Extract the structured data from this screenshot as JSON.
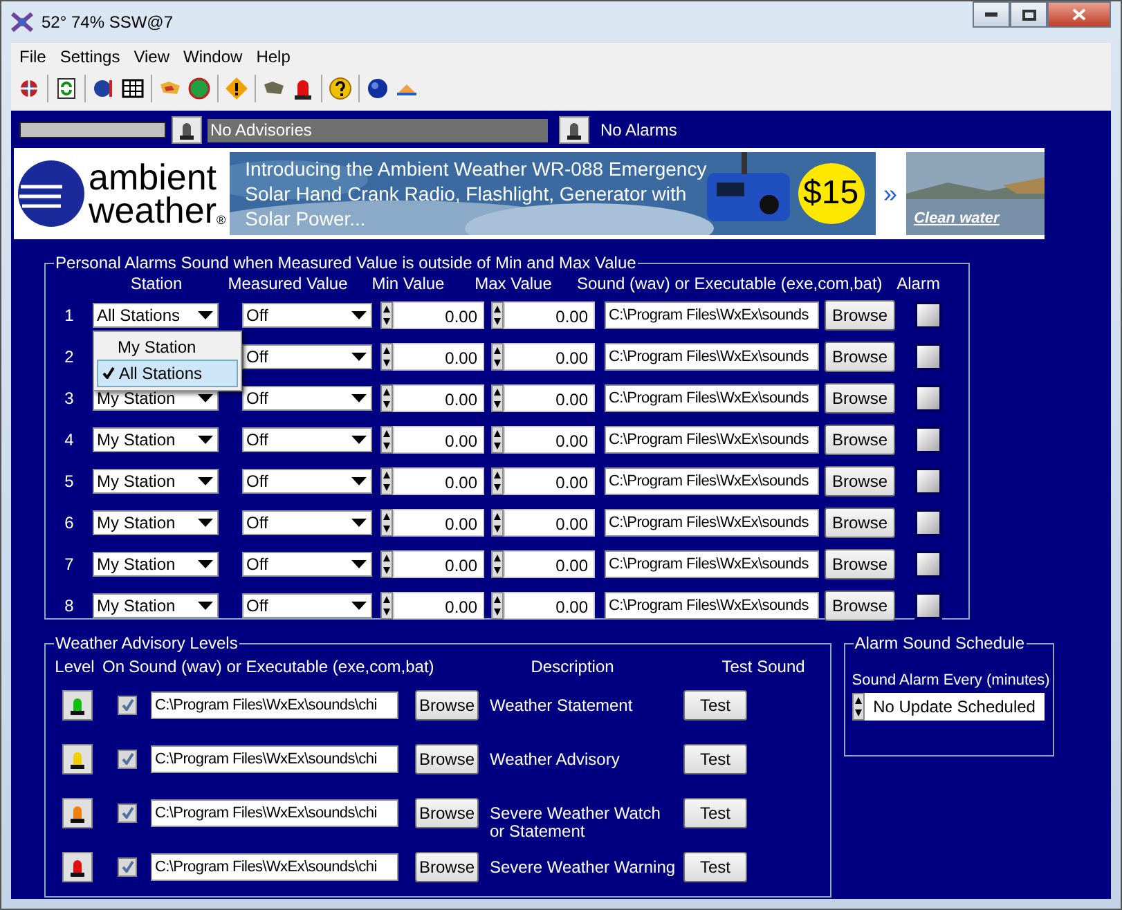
{
  "window": {
    "title": "52° 74% SSW@7"
  },
  "menu": [
    "File",
    "Settings",
    "View",
    "Window",
    "Help"
  ],
  "status": {
    "advisories": "No Advisories",
    "alarms": "No Alarms"
  },
  "banner": {
    "logo_top": "ambient",
    "logo_bottom": "weather",
    "logo_mark": "®",
    "ad_text": "Introducing the Ambient Weather WR-088 Emergency Solar Hand Crank Radio, Flashlight, Generator with Solar Power...",
    "price": "$15",
    "more": "»",
    "side_link": "Clean water"
  },
  "alarms": {
    "legend": "Personal Alarms Sound when Measured Value is outside of Min and Max Value",
    "columns": [
      "Station",
      "Measured Value",
      "Min Value",
      "Max Value",
      "Sound (wav) or  Executable (exe,com,bat)",
      "Alarm"
    ],
    "rows": [
      {
        "number": "1",
        "station": "All Stations",
        "measured": "Off",
        "min": "0.00",
        "max": "0.00",
        "sound": "C:\\Program Files\\WxEx\\sounds",
        "browse": "Browse",
        "alarm": false
      },
      {
        "number": "2",
        "measured": "Off",
        "min": "0.00",
        "max": "0.00",
        "sound": "C:\\Program Files\\WxEx\\sounds",
        "browse": "Browse",
        "alarm": false
      },
      {
        "number": "3",
        "station": "My Station",
        "measured": "Off",
        "min": "0.00",
        "max": "0.00",
        "sound": "C:\\Program Files\\WxEx\\sounds",
        "browse": "Browse",
        "alarm": false
      },
      {
        "number": "4",
        "station": "My Station",
        "measured": "Off",
        "min": "0.00",
        "max": "0.00",
        "sound": "C:\\Program Files\\WxEx\\sounds",
        "browse": "Browse",
        "alarm": false
      },
      {
        "number": "5",
        "station": "My Station",
        "measured": "Off",
        "min": "0.00",
        "max": "0.00",
        "sound": "C:\\Program Files\\WxEx\\sounds",
        "browse": "Browse",
        "alarm": false
      },
      {
        "number": "6",
        "station": "My Station",
        "measured": "Off",
        "min": "0.00",
        "max": "0.00",
        "sound": "C:\\Program Files\\WxEx\\sounds",
        "browse": "Browse",
        "alarm": false
      },
      {
        "number": "7",
        "station": "My Station",
        "measured": "Off",
        "min": "0.00",
        "max": "0.00",
        "sound": "C:\\Program Files\\WxEx\\sounds",
        "browse": "Browse",
        "alarm": false
      },
      {
        "number": "8",
        "station": "My Station",
        "measured": "Off",
        "min": "0.00",
        "max": "0.00",
        "sound": "C:\\Program Files\\WxEx\\sounds",
        "browse": "Browse",
        "alarm": false
      }
    ],
    "station_menu": [
      {
        "label": "My Station",
        "selected": false
      },
      {
        "label": "All Stations",
        "selected": true
      }
    ]
  },
  "advisory": {
    "legend": "Weather Advisory Levels",
    "columns": [
      "Level",
      "On",
      "Sound (wav) or  Executable (exe,com,bat)",
      "Description",
      "Test Sound"
    ],
    "rows": [
      {
        "color": "#10c010",
        "on": true,
        "sound": "C:\\Program Files\\WxEx\\sounds\\chi",
        "browse": "Browse",
        "description": "Weather Statement",
        "test": "Test"
      },
      {
        "color": "#f0d000",
        "on": true,
        "sound": "C:\\Program Files\\WxEx\\sounds\\chi",
        "browse": "Browse",
        "description": "Weather Advisory",
        "test": "Test"
      },
      {
        "color": "#f08010",
        "on": true,
        "sound": "C:\\Program Files\\WxEx\\sounds\\chi",
        "browse": "Browse",
        "description": "Severe Weather Watch or Statement",
        "test": "Test"
      },
      {
        "color": "#e01010",
        "on": true,
        "sound": "C:\\Program Files\\WxEx\\sounds\\chi",
        "browse": "Browse",
        "description": "Severe Weather Warning",
        "test": "Test"
      }
    ]
  },
  "schedule": {
    "legend": "Alarm Sound Schedule",
    "label": "Sound Alarm Every (minutes)",
    "value": "No Update Scheduled"
  }
}
